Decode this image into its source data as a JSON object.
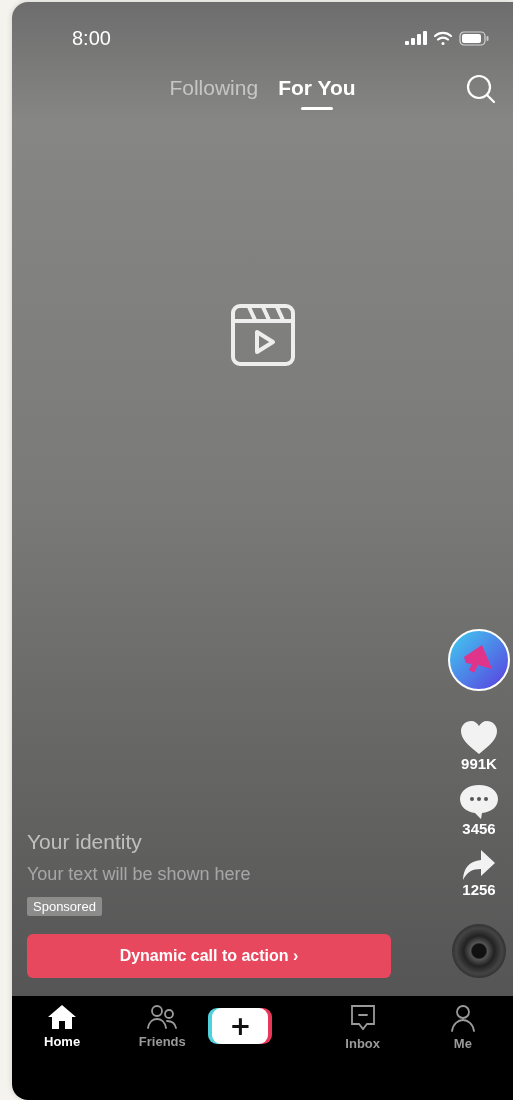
{
  "status_bar": {
    "time": "8:00"
  },
  "tabs": [
    {
      "label": "Following",
      "selected": false
    },
    {
      "label": "For You",
      "selected": true
    }
  ],
  "post": {
    "identity": "Your identity",
    "caption": "Your text will be shown here",
    "badge": "Sponsored",
    "cta": "Dynamic call to action ›"
  },
  "actions": [
    {
      "kind": "like",
      "count": "991K"
    },
    {
      "kind": "comment",
      "count": "3456"
    },
    {
      "kind": "share",
      "count": "1256"
    }
  ],
  "nav": [
    {
      "kind": "home",
      "label": "Home",
      "selected": true
    },
    {
      "kind": "friends",
      "label": "Friends",
      "selected": false
    },
    {
      "kind": "create",
      "label": "+"
    },
    {
      "kind": "inbox",
      "label": "Inbox",
      "selected": false
    },
    {
      "kind": "me",
      "label": "Me",
      "selected": false
    }
  ]
}
